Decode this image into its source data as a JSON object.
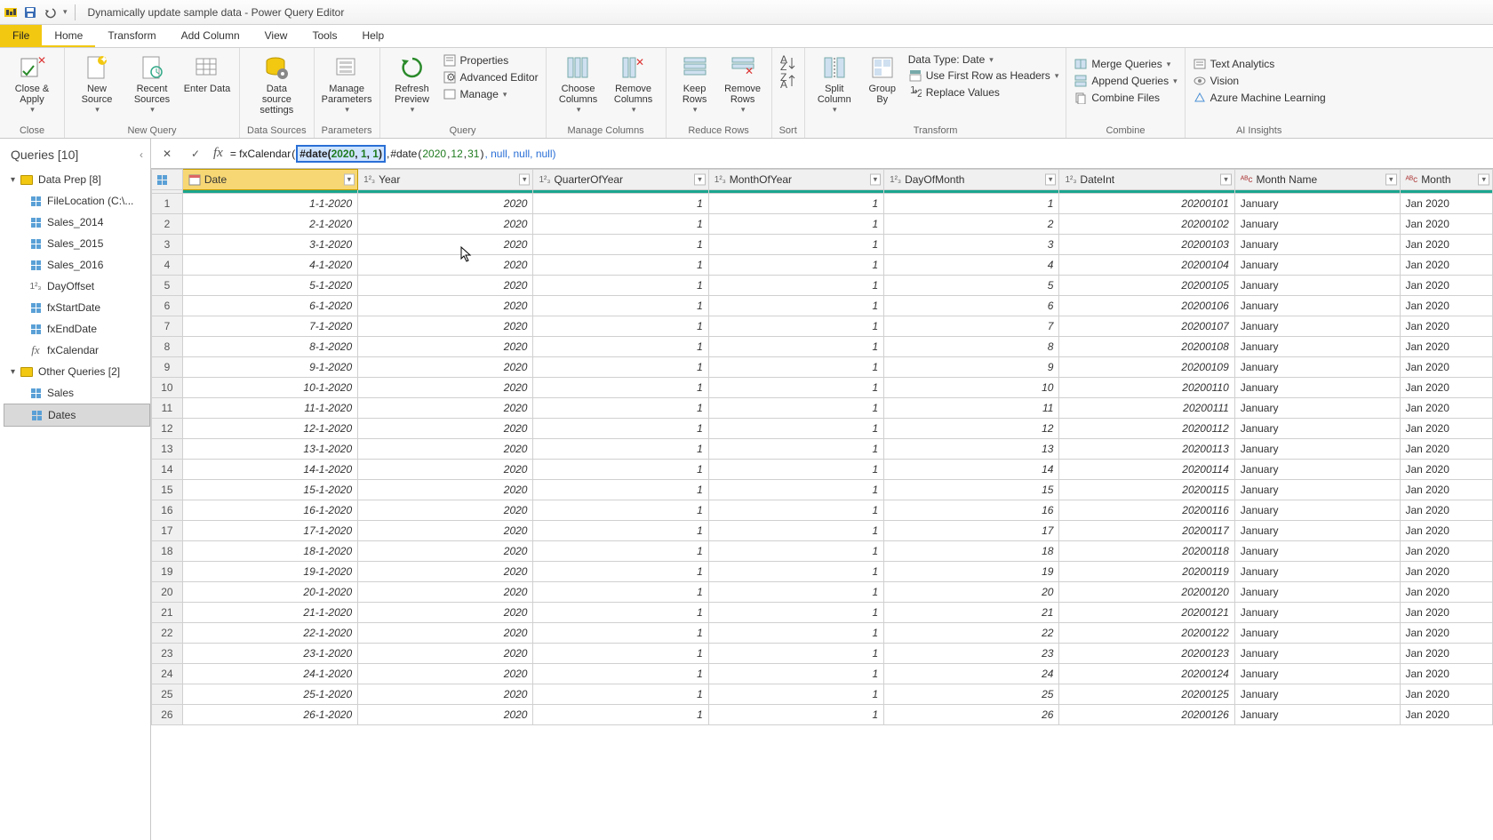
{
  "title": "Dynamically update sample data - Power Query Editor",
  "menu": {
    "file": "File",
    "home": "Home",
    "transform": "Transform",
    "addcol": "Add Column",
    "view": "View",
    "tools": "Tools",
    "help": "Help"
  },
  "ribbon": {
    "close": {
      "label": "Close &\nApply",
      "group": "Close"
    },
    "new_source": "New\nSource",
    "recent": "Recent\nSources",
    "enter": "Enter\nData",
    "newquery_group": "New Query",
    "dsettings": "Data source\nsettings",
    "dsettings_group": "Data Sources",
    "params": "Manage\nParameters",
    "params_group": "Parameters",
    "refresh": "Refresh\nPreview",
    "properties": "Properties",
    "adv": "Advanced Editor",
    "manage": "Manage",
    "query_group": "Query",
    "choosecols": "Choose\nColumns",
    "removecols": "Remove\nColumns",
    "managecols_group": "Manage Columns",
    "keeprows": "Keep\nRows",
    "removerows": "Remove\nRows",
    "reducerows_group": "Reduce Rows",
    "sort_group": "Sort",
    "split": "Split\nColumn",
    "groupby": "Group\nBy",
    "datatype": "Data Type: Date",
    "firstrow": "Use First Row as Headers",
    "replace": "Replace Values",
    "transform_group": "Transform",
    "merge": "Merge Queries",
    "append": "Append Queries",
    "combinefiles": "Combine Files",
    "combine_group": "Combine",
    "textanalytics": "Text Analytics",
    "vision": "Vision",
    "azml": "Azure Machine Learning",
    "ai_group": "AI Insights"
  },
  "queries": {
    "title": "Queries [10]",
    "g1": "Data Prep [8]",
    "items1": [
      "FileLocation (C:\\...",
      "Sales_2014",
      "Sales_2015",
      "Sales_2016",
      "DayOffset",
      "fxStartDate",
      "fxEndDate",
      "fxCalendar"
    ],
    "g2": "Other Queries [2]",
    "items2": [
      "Sales",
      "Dates"
    ]
  },
  "formula": {
    "prefix": "= fxCalendar",
    "open": "(",
    "highlighted_fn": "#date",
    "highlighted_args_open": "(",
    "h_y": "2020",
    "h_c1": ", ",
    "h_m": "1",
    "h_c2": ", ",
    "h_d": "1",
    "highlighted_close": ")",
    "comma": ", ",
    "rest_fn": "#date",
    "rest_open": "(",
    "r_y": "2020",
    "r_c1": ", ",
    "r_m": "12",
    "r_c2": ", ",
    "r_d": "31",
    "rest_close": ")",
    "tail": ", null, null, null)"
  },
  "columns": [
    {
      "name": "Date",
      "type": "date",
      "selected": true
    },
    {
      "name": "Year",
      "type": "num"
    },
    {
      "name": "QuarterOfYear",
      "type": "num"
    },
    {
      "name": "MonthOfYear",
      "type": "num"
    },
    {
      "name": "DayOfMonth",
      "type": "num"
    },
    {
      "name": "DateInt",
      "type": "num"
    },
    {
      "name": "Month Name",
      "type": "text"
    },
    {
      "name": "Month",
      "type": "text"
    }
  ],
  "rows": [
    [
      "1-1-2020",
      "2020",
      "1",
      "1",
      "1",
      "20200101",
      "January",
      "Jan 2020"
    ],
    [
      "2-1-2020",
      "2020",
      "1",
      "1",
      "2",
      "20200102",
      "January",
      "Jan 2020"
    ],
    [
      "3-1-2020",
      "2020",
      "1",
      "1",
      "3",
      "20200103",
      "January",
      "Jan 2020"
    ],
    [
      "4-1-2020",
      "2020",
      "1",
      "1",
      "4",
      "20200104",
      "January",
      "Jan 2020"
    ],
    [
      "5-1-2020",
      "2020",
      "1",
      "1",
      "5",
      "20200105",
      "January",
      "Jan 2020"
    ],
    [
      "6-1-2020",
      "2020",
      "1",
      "1",
      "6",
      "20200106",
      "January",
      "Jan 2020"
    ],
    [
      "7-1-2020",
      "2020",
      "1",
      "1",
      "7",
      "20200107",
      "January",
      "Jan 2020"
    ],
    [
      "8-1-2020",
      "2020",
      "1",
      "1",
      "8",
      "20200108",
      "January",
      "Jan 2020"
    ],
    [
      "9-1-2020",
      "2020",
      "1",
      "1",
      "9",
      "20200109",
      "January",
      "Jan 2020"
    ],
    [
      "10-1-2020",
      "2020",
      "1",
      "1",
      "10",
      "20200110",
      "January",
      "Jan 2020"
    ],
    [
      "11-1-2020",
      "2020",
      "1",
      "1",
      "11",
      "20200111",
      "January",
      "Jan 2020"
    ],
    [
      "12-1-2020",
      "2020",
      "1",
      "1",
      "12",
      "20200112",
      "January",
      "Jan 2020"
    ],
    [
      "13-1-2020",
      "2020",
      "1",
      "1",
      "13",
      "20200113",
      "January",
      "Jan 2020"
    ],
    [
      "14-1-2020",
      "2020",
      "1",
      "1",
      "14",
      "20200114",
      "January",
      "Jan 2020"
    ],
    [
      "15-1-2020",
      "2020",
      "1",
      "1",
      "15",
      "20200115",
      "January",
      "Jan 2020"
    ],
    [
      "16-1-2020",
      "2020",
      "1",
      "1",
      "16",
      "20200116",
      "January",
      "Jan 2020"
    ],
    [
      "17-1-2020",
      "2020",
      "1",
      "1",
      "17",
      "20200117",
      "January",
      "Jan 2020"
    ],
    [
      "18-1-2020",
      "2020",
      "1",
      "1",
      "18",
      "20200118",
      "January",
      "Jan 2020"
    ],
    [
      "19-1-2020",
      "2020",
      "1",
      "1",
      "19",
      "20200119",
      "January",
      "Jan 2020"
    ],
    [
      "20-1-2020",
      "2020",
      "1",
      "1",
      "20",
      "20200120",
      "January",
      "Jan 2020"
    ],
    [
      "21-1-2020",
      "2020",
      "1",
      "1",
      "21",
      "20200121",
      "January",
      "Jan 2020"
    ],
    [
      "22-1-2020",
      "2020",
      "1",
      "1",
      "22",
      "20200122",
      "January",
      "Jan 2020"
    ],
    [
      "23-1-2020",
      "2020",
      "1",
      "1",
      "23",
      "20200123",
      "January",
      "Jan 2020"
    ],
    [
      "24-1-2020",
      "2020",
      "1",
      "1",
      "24",
      "20200124",
      "January",
      "Jan 2020"
    ],
    [
      "25-1-2020",
      "2020",
      "1",
      "1",
      "25",
      "20200125",
      "January",
      "Jan 2020"
    ],
    [
      "26-1-2020",
      "2020",
      "1",
      "1",
      "26",
      "20200126",
      "January",
      "Jan 2020"
    ]
  ]
}
